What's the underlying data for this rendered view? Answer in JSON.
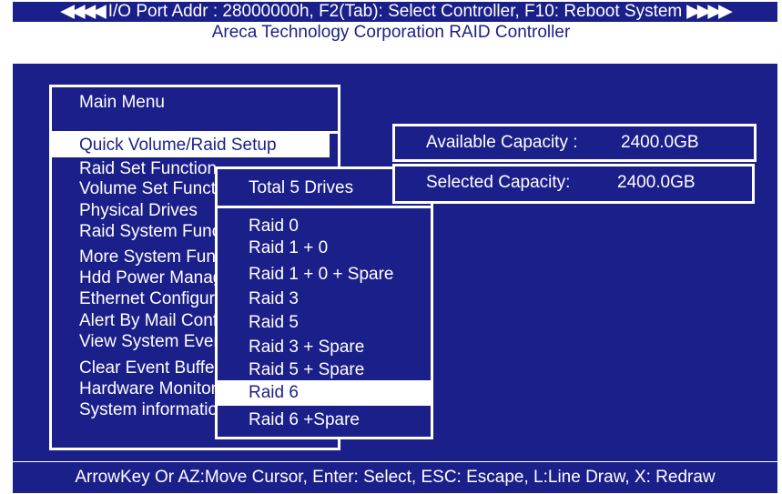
{
  "header": {
    "left_arrows": "◀◀◀◀",
    "text": "I/O Port Addr : 28000000h, F2(Tab): Select Controller, F10: Reboot System",
    "right_arrows": "▶▶▶▶",
    "subtitle": "Areca Technology Corporation RAID Controller"
  },
  "main_menu": {
    "title": "Main Menu",
    "items": [
      "Quick Volume/Raid Setup",
      "Raid Set Function",
      "Volume Set Function",
      "Physical Drives",
      "Raid System Function",
      "More System Functions",
      "Hdd Power Management",
      "Ethernet Configuration",
      "Alert By Mail Config",
      "View System Events",
      "Clear Event Buffer",
      "Hardware Monitor",
      "System information"
    ],
    "selected_index": 0
  },
  "drives_popup": {
    "title": "Total 5 Drives",
    "options": [
      "Raid 0",
      "Raid 1 + 0",
      "Raid 1 + 0 + Spare",
      "Raid 3",
      "Raid 5",
      "Raid 3 + Spare",
      "Raid 5 + Spare",
      "Raid 6",
      "Raid 6 +Spare"
    ],
    "selected_index": 7
  },
  "capacity": {
    "available_label": "Available Capacity :",
    "available_value": "2400.0GB",
    "selected_label": "Selected Capacity:",
    "selected_value": "2400.0GB"
  },
  "footer": {
    "text": "ArrowKey Or AZ:Move Cursor, Enter: Select, ESC: Escape, L:Line Draw, X: Redraw"
  },
  "colors": {
    "background": "#1b1f8a",
    "text": "#ffffff",
    "highlight_bg": "#ffffff",
    "highlight_text": "#1b1f8a"
  }
}
